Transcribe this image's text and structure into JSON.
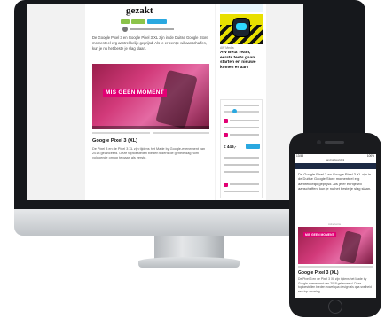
{
  "desktop": {
    "article": {
      "title": "gezakt",
      "intro": "De Google Pixel 3 en Google Pixel 3 XL zijn in de Duitse Google Store momenteel erg aantrekkelijk geprijsd. Als je er eentje wil aanschaffen, kun je nu het beste je slag slaan.",
      "hero_banner": "MIS GEEN MOMENT",
      "section_heading": "Google Pixel 3 (XL)",
      "body": "De Pixel 3 en de Pixel 3 XL zijn tijdens het Made by Google-evenement van 2018 gelanceerd. Deze toptoestellen bieden tijdens de gehele dag ruim voldoende om op te gaan als eerste."
    },
    "sidebar": {
      "kicker": "AW Media",
      "title": "AW Beta Team, eerste tests gaan starten en nieuwe komen er aan!",
      "widget_price": "€ 449,-"
    }
  },
  "phone": {
    "status_time": "13:58",
    "status_right": "100%",
    "url": "androidworld.nl",
    "intro": "De Google Pixel 3 en Google Pixel 3 XL zijn in de Duitse Google Store momenteel erg aantrekkelijk geprijsd. Als je er eentje wil aanschaffen, kun je nu het beste je slag slaan.",
    "ad_label": "Advertentie",
    "hero_banner": "MIS GEEN MOMENT",
    "section_heading": "Google Pixel 3 (XL)",
    "body": "De Pixel 3 en de Pixel 3 XL zijn tijdens het Made by Google-evenement van 2018 gelanceerd. Deze toptoestellen bieden zowel qua design als qua snelheid een top-ervaring."
  }
}
